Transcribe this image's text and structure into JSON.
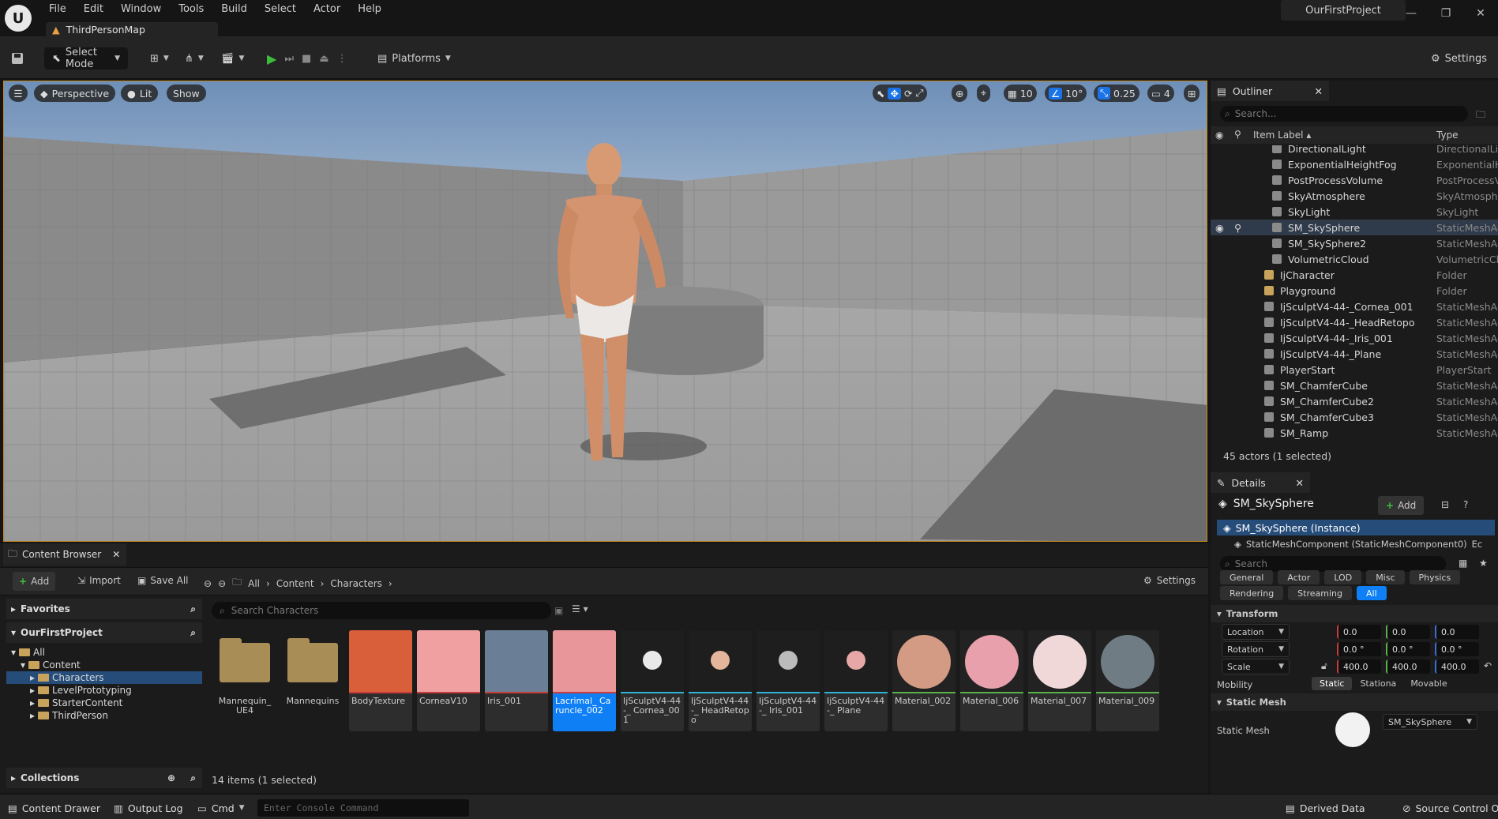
{
  "app": {
    "logo": "U",
    "project_name": "OurFirstProject",
    "map_tab": "ThirdPersonMap"
  },
  "menu": [
    "File",
    "Edit",
    "Window",
    "Tools",
    "Build",
    "Select",
    "Actor",
    "Help"
  ],
  "toolbar": {
    "select_mode": "Select Mode",
    "platforms": "Platforms",
    "settings": "Settings"
  },
  "viewport": {
    "perspective": "Perspective",
    "lit": "Lit",
    "show": "Show",
    "grid_snap": "10",
    "rot_snap": "10°",
    "scale_snap": "0.25",
    "cam_speed": "4"
  },
  "content_browser": {
    "tab": "Content Browser",
    "add": "Add",
    "import": "Import",
    "save_all": "Save All",
    "breadcrumb": [
      "All",
      "Content",
      "Characters"
    ],
    "settings": "Settings",
    "favorites": "Favorites",
    "project": "OurFirstProject",
    "collections": "Collections",
    "tree": [
      "All",
      "Content",
      "Characters",
      "LevelPrototyping",
      "StarterContent",
      "ThirdPerson"
    ],
    "search_placeholder": "Search Characters",
    "items_count": "14 items (1 selected)",
    "assets": [
      {
        "label": "Mannequin_ UE4",
        "kind": "folder"
      },
      {
        "label": "Mannequins",
        "kind": "folder"
      },
      {
        "label": "BodyTexture",
        "kind": "texture",
        "color": "#d95f3a"
      },
      {
        "label": "CorneaV10",
        "kind": "texture",
        "color": "#f0a0a0"
      },
      {
        "label": "Iris_001",
        "kind": "texture",
        "color": "#6a7f95"
      },
      {
        "label": "Lacrimal_ Caruncle_002",
        "kind": "texture",
        "color": "#e8969a"
      },
      {
        "label": "IjSculptV4-44-_ Cornea_001",
        "kind": "mesh",
        "color": "#e9e9e9"
      },
      {
        "label": "IjSculptV4-44-_ HeadRetopo",
        "kind": "mesh",
        "color": "#e3b69b"
      },
      {
        "label": "IjSculptV4-44-_ Iris_001",
        "kind": "mesh",
        "color": "#bbbbbb"
      },
      {
        "label": "IjSculptV4-44-_ Plane",
        "kind": "mesh",
        "color": "#e7a7a7"
      },
      {
        "label": "Material_002",
        "kind": "material",
        "color": "#d49b84"
      },
      {
        "label": "Material_006",
        "kind": "material",
        "color": "#e9a0ad"
      },
      {
        "label": "Material_007",
        "kind": "material",
        "color": "#f1d8d8"
      },
      {
        "label": "Material_009",
        "kind": "material",
        "color": "#6f7c84"
      }
    ]
  },
  "statusbar": {
    "content_drawer": "Content Drawer",
    "output_log": "Output Log",
    "cmd": "Cmd",
    "console_placeholder": "Enter Console Command",
    "derived_data": "Derived Data",
    "source_control": "Source Control Of"
  },
  "outliner": {
    "tab": "Outliner",
    "search_placeholder": "Search...",
    "col_label": "Item Label",
    "col_type": "Type",
    "rows": [
      {
        "name": "DirectionalLight",
        "type": "DirectionalLig"
      },
      {
        "name": "ExponentialHeightFog",
        "type": "ExponentialHe"
      },
      {
        "name": "PostProcessVolume",
        "type": "PostProcessV"
      },
      {
        "name": "SkyAtmosphere",
        "type": "SkyAtmosphe"
      },
      {
        "name": "SkyLight",
        "type": "SkyLight"
      },
      {
        "name": "SM_SkySphere",
        "type": "StaticMeshAc"
      },
      {
        "name": "SM_SkySphere2",
        "type": "StaticMeshAc"
      },
      {
        "name": "VolumetricCloud",
        "type": "VolumetricClo"
      },
      {
        "name": "IjCharacter",
        "type": "Folder"
      },
      {
        "name": "Playground",
        "type": "Folder"
      },
      {
        "name": "IjSculptV4-44-_Cornea_001",
        "type": "StaticMeshAc"
      },
      {
        "name": "IjSculptV4-44-_HeadRetopo",
        "type": "StaticMeshAc"
      },
      {
        "name": "IjSculptV4-44-_Iris_001",
        "type": "StaticMeshAc"
      },
      {
        "name": "IjSculptV4-44-_Plane",
        "type": "StaticMeshAc"
      },
      {
        "name": "PlayerStart",
        "type": "PlayerStart"
      },
      {
        "name": "SM_ChamferCube",
        "type": "StaticMeshAc"
      },
      {
        "name": "SM_ChamferCube2",
        "type": "StaticMeshAc"
      },
      {
        "name": "SM_ChamferCube3",
        "type": "StaticMeshAc"
      },
      {
        "name": "SM_Ramp",
        "type": "StaticMeshAc"
      }
    ],
    "actor_count": "45 actors (1 selected)"
  },
  "details": {
    "tab": "Details",
    "actor_name": "SM_SkySphere",
    "add": "Add",
    "instance": "SM_SkySphere (Instance)",
    "component": "StaticMeshComponent (StaticMeshComponent0)",
    "component_suffix": "Ec",
    "search_placeholder": "Search",
    "filters": [
      "General",
      "Actor",
      "LOD",
      "Misc",
      "Physics",
      "Rendering",
      "Streaming",
      "All"
    ],
    "transform": "Transform",
    "location": {
      "label": "Location",
      "x": "0.0",
      "y": "0.0",
      "z": "0.0"
    },
    "rotation": {
      "label": "Rotation",
      "x": "0.0 °",
      "y": "0.0 °",
      "z": "0.0 °"
    },
    "scale": {
      "label": "Scale",
      "x": "400.0",
      "y": "400.0",
      "z": "400.0"
    },
    "mobility": {
      "label": "Mobility",
      "options": [
        "Static",
        "Stationa",
        "Movable"
      ]
    },
    "static_mesh_section": "Static Mesh",
    "static_mesh_label": "Static Mesh",
    "static_mesh_value": "SM_SkySphere"
  },
  "colors": {
    "accent": "#0e7ff5",
    "selection_outline": "#c28a1e",
    "x_axis": "#c83c3c",
    "y_axis": "#5ab14a",
    "z_axis": "#3c6fd6"
  }
}
